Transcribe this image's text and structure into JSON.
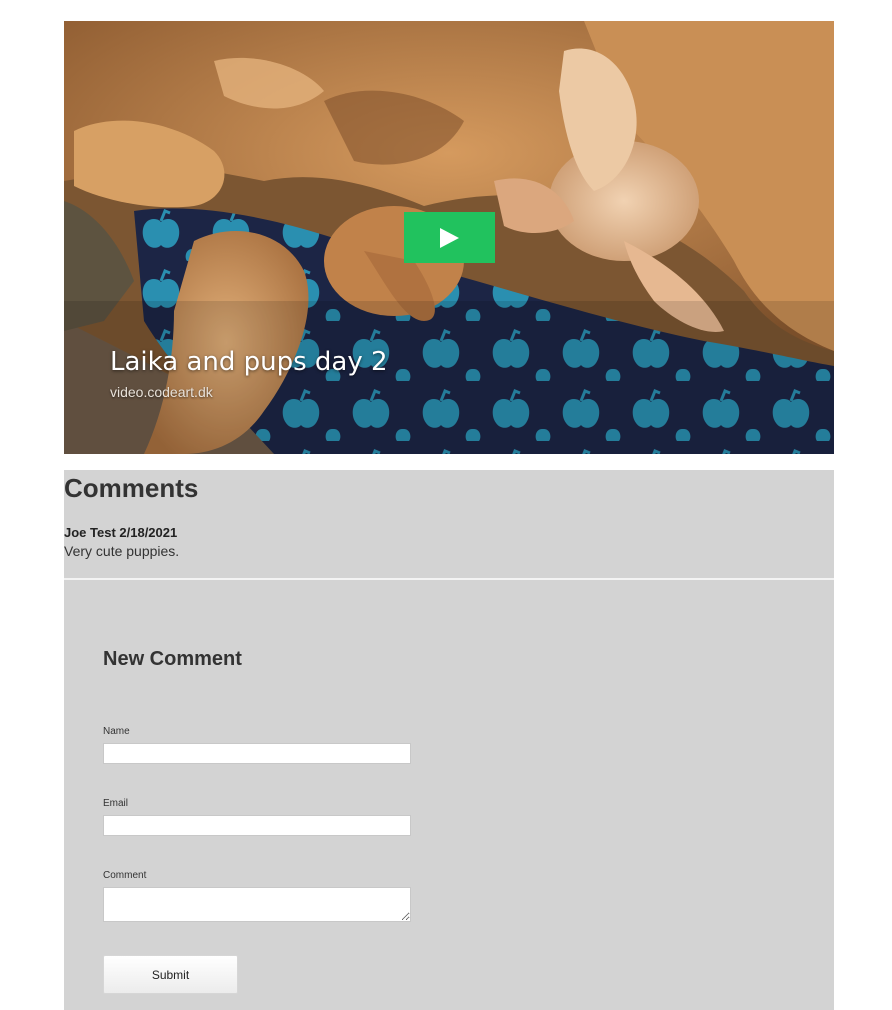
{
  "video": {
    "title": "Laika and pups day 2",
    "source": "video.codeart.dk",
    "play_icon": "play-icon",
    "play_color": "#21c25e"
  },
  "comments": {
    "heading": "Comments",
    "items": [
      {
        "meta": "Joe Test 2/18/2021",
        "body": "Very cute puppies."
      }
    ]
  },
  "form": {
    "heading": "New Comment",
    "name_label": "Name",
    "name_value": "",
    "email_label": "Email",
    "email_value": "",
    "comment_label": "Comment",
    "comment_value": "",
    "submit_label": "Submit"
  },
  "colors": {
    "panel_background": "#d3d3d3",
    "heading_text": "#333333"
  }
}
